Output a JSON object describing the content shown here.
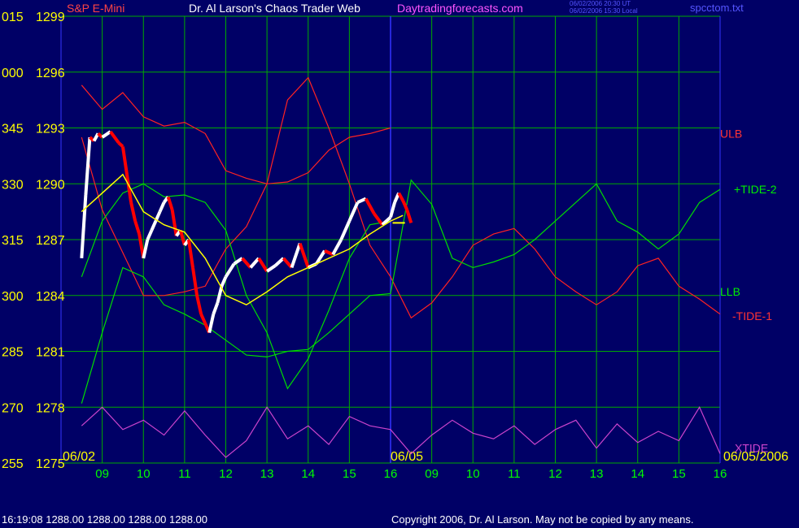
{
  "header": {
    "title": "Dr. Al Larson's Chaos Trader Web",
    "site": "Daytradingforecasts.com",
    "instrument": "S&P E-Mini",
    "stamp_line1": "06/02/2006 20:30 UT",
    "stamp_line2": "06/02/2006 15:30 Local",
    "file": "spcctom.txt"
  },
  "footer": {
    "quote": "16:19:08  1288.00  1288.00  1288.00  1288.00",
    "copyright": "Copyright 2006, Dr. Al Larson. May not be copied by any means."
  },
  "colors": {
    "background": "#000066",
    "grid": "#00aa00",
    "price_up": "#ffffff",
    "price_down": "#ff0000",
    "ulb_llb_bands": "#ff2222",
    "tide_green": "#00dd00",
    "xtide": "#cc44cc",
    "axis_labels": "#ffff00",
    "time_labels": "#00ff00"
  },
  "chart_data": {
    "type": "line",
    "title": "S&P E-Mini",
    "y_axis": {
      "ylim": [
        1275,
        1299
      ],
      "angle_ticks": [
        "015",
        "000",
        "345",
        "330",
        "315",
        "300",
        "285",
        "270",
        "255"
      ],
      "price_ticks": [
        "1299",
        "1296",
        "1293",
        "1290",
        "1287",
        "1284",
        "1281",
        "1278",
        "1275"
      ]
    },
    "x_axis": {
      "date_labels": [
        "06/02",
        "06/05",
        "06/05/2006"
      ],
      "hour_labels": [
        "09",
        "10",
        "11",
        "12",
        "13",
        "14",
        "15",
        "16",
        "09",
        "10",
        "11",
        "12",
        "13",
        "14",
        "15",
        "16"
      ]
    },
    "line_labels": [
      "ULB",
      "+TIDE-2",
      "LLB",
      "-TIDE-1",
      "XTIDE"
    ],
    "last_price": 1287.9,
    "series": [
      {
        "name": "ULB",
        "color": "#ff2222",
        "points": [
          [
            8.5,
            1295.3
          ],
          [
            9.0,
            1294.0
          ],
          [
            9.5,
            1294.9
          ],
          [
            10.0,
            1293.6
          ],
          [
            10.5,
            1293.1
          ],
          [
            11.0,
            1293.3
          ],
          [
            11.5,
            1292.7
          ],
          [
            12.0,
            1290.7
          ],
          [
            12.5,
            1290.3
          ],
          [
            13.0,
            1290.0
          ],
          [
            13.5,
            1290.1
          ],
          [
            14.0,
            1290.6
          ],
          [
            14.5,
            1291.8
          ],
          [
            15.0,
            1292.5
          ],
          [
            15.5,
            1292.7
          ],
          [
            16.0,
            1293.0
          ]
        ]
      },
      {
        "name": "LLB",
        "color": "#ff2222",
        "points": [
          [
            8.5,
            1292.5
          ],
          [
            9.0,
            1288.6
          ],
          [
            9.5,
            1286.3
          ],
          [
            10.0,
            1284.0
          ],
          [
            10.5,
            1284.0
          ],
          [
            11.0,
            1284.2
          ],
          [
            11.5,
            1284.5
          ],
          [
            12.0,
            1286.5
          ],
          [
            12.5,
            1287.7
          ],
          [
            13.0,
            1290.0
          ],
          [
            13.5,
            1294.5
          ],
          [
            14.0,
            1295.7
          ],
          [
            14.5,
            1293.0
          ],
          [
            15.0,
            1290.0
          ],
          [
            15.5,
            1286.7
          ],
          [
            16.0,
            1285.0
          ],
          [
            16.5,
            1282.8
          ],
          [
            17.0,
            1283.6
          ],
          [
            17.5,
            1285.0
          ],
          [
            18.0,
            1286.7
          ],
          [
            18.5,
            1287.3
          ],
          [
            19.0,
            1287.6
          ],
          [
            19.5,
            1286.5
          ],
          [
            20.0,
            1285.0
          ],
          [
            20.5,
            1284.2
          ],
          [
            21.0,
            1283.5
          ],
          [
            21.5,
            1284.2
          ],
          [
            22.0,
            1285.6
          ],
          [
            22.5,
            1286.0
          ],
          [
            23.0,
            1284.5
          ],
          [
            23.5,
            1283.8
          ],
          [
            24.0,
            1283.0
          ]
        ]
      },
      {
        "name": "+TIDE-2",
        "color": "#00dd00",
        "points": [
          [
            8.5,
            1278.2
          ],
          [
            9.0,
            1282.0
          ],
          [
            9.5,
            1285.5
          ],
          [
            10.0,
            1285.0
          ],
          [
            10.5,
            1283.5
          ],
          [
            11.0,
            1283.0
          ],
          [
            11.5,
            1282.4
          ],
          [
            12.0,
            1281.6
          ],
          [
            12.5,
            1280.8
          ],
          [
            13.0,
            1280.7
          ],
          [
            13.5,
            1281.0
          ],
          [
            14.0,
            1281.1
          ],
          [
            14.5,
            1282.0
          ],
          [
            15.0,
            1283.0
          ],
          [
            15.5,
            1284.0
          ],
          [
            16.0,
            1284.1
          ],
          [
            16.5,
            1290.2
          ],
          [
            17.0,
            1288.9
          ],
          [
            17.5,
            1286.0
          ],
          [
            18.0,
            1285.5
          ],
          [
            18.5,
            1285.8
          ],
          [
            19.0,
            1286.2
          ],
          [
            19.5,
            1287.0
          ],
          [
            20.0,
            1288.0
          ],
          [
            20.5,
            1289.0
          ],
          [
            21.0,
            1290.0
          ],
          [
            21.5,
            1288.0
          ],
          [
            22.0,
            1287.4
          ],
          [
            22.5,
            1286.5
          ],
          [
            23.0,
            1287.3
          ],
          [
            23.5,
            1289.0
          ],
          [
            24.0,
            1289.7
          ]
        ]
      },
      {
        "name": "-TIDE-1",
        "color": "#00dd00",
        "points": [
          [
            8.5,
            1285.0
          ],
          [
            9.0,
            1288.0
          ],
          [
            9.5,
            1289.5
          ],
          [
            10.0,
            1290.0
          ],
          [
            10.5,
            1289.3
          ],
          [
            11.0,
            1289.4
          ],
          [
            11.5,
            1289.0
          ],
          [
            12.0,
            1287.5
          ],
          [
            12.5,
            1284.0
          ],
          [
            13.0,
            1282.0
          ],
          [
            13.5,
            1279.0
          ],
          [
            14.0,
            1280.6
          ],
          [
            14.5,
            1283.2
          ],
          [
            15.0,
            1286.0
          ],
          [
            15.5,
            1287.8
          ],
          [
            16.0,
            1288.0
          ]
        ]
      },
      {
        "name": "XTIDE",
        "color": "#cc44cc",
        "points": [
          [
            8.5,
            1277.0
          ],
          [
            9.0,
            1278.0
          ],
          [
            9.5,
            1276.8
          ],
          [
            10.0,
            1277.3
          ],
          [
            10.5,
            1276.5
          ],
          [
            11.0,
            1277.8
          ],
          [
            11.5,
            1276.5
          ],
          [
            12.0,
            1275.3
          ],
          [
            12.5,
            1276.2
          ],
          [
            13.0,
            1278.0
          ],
          [
            13.5,
            1276.3
          ],
          [
            14.0,
            1277.0
          ],
          [
            14.5,
            1276.0
          ],
          [
            15.0,
            1277.5
          ],
          [
            15.5,
            1277.0
          ],
          [
            16.0,
            1276.8
          ],
          [
            16.5,
            1275.5
          ],
          [
            17.0,
            1276.5
          ],
          [
            17.5,
            1277.3
          ],
          [
            18.0,
            1276.6
          ],
          [
            18.5,
            1276.3
          ],
          [
            19.0,
            1277.0
          ],
          [
            19.5,
            1276.0
          ],
          [
            20.0,
            1276.8
          ],
          [
            20.5,
            1277.3
          ],
          [
            21.0,
            1275.8
          ],
          [
            21.5,
            1277.1
          ],
          [
            22.0,
            1276.1
          ],
          [
            22.5,
            1276.7
          ],
          [
            23.0,
            1276.2
          ],
          [
            23.5,
            1278.0
          ],
          [
            24.0,
            1275.5
          ]
        ]
      },
      {
        "name": "price",
        "color": "#ffffff",
        "points": [
          [
            8.5,
            1286.0
          ],
          [
            8.6,
            1289.4
          ],
          [
            8.7,
            1292.5
          ],
          [
            8.8,
            1292.3
          ],
          [
            8.9,
            1292.7
          ],
          [
            9.0,
            1292.5
          ],
          [
            9.2,
            1292.8
          ],
          [
            9.4,
            1292.2
          ],
          [
            9.5,
            1292.0
          ],
          [
            9.6,
            1290.5
          ],
          [
            9.7,
            1289.0
          ],
          [
            9.8,
            1288.0
          ],
          [
            9.9,
            1287.3
          ],
          [
            10.0,
            1286.0
          ],
          [
            10.1,
            1287.0
          ],
          [
            10.2,
            1287.5
          ],
          [
            10.3,
            1288.0
          ],
          [
            10.4,
            1288.5
          ],
          [
            10.5,
            1289.0
          ],
          [
            10.6,
            1289.3
          ],
          [
            10.7,
            1288.6
          ],
          [
            10.8,
            1287.2
          ],
          [
            10.9,
            1287.5
          ],
          [
            11.0,
            1286.7
          ],
          [
            11.1,
            1287.0
          ],
          [
            11.2,
            1285.5
          ],
          [
            11.3,
            1284.0
          ],
          [
            11.4,
            1283.0
          ],
          [
            11.5,
            1282.5
          ],
          [
            11.6,
            1282.0
          ],
          [
            11.7,
            1283.0
          ],
          [
            11.8,
            1283.6
          ],
          [
            11.9,
            1284.5
          ],
          [
            12.0,
            1285.0
          ],
          [
            12.2,
            1285.7
          ],
          [
            12.4,
            1286.0
          ],
          [
            12.6,
            1285.5
          ],
          [
            12.8,
            1286.0
          ],
          [
            13.0,
            1285.3
          ],
          [
            13.2,
            1285.6
          ],
          [
            13.4,
            1286.0
          ],
          [
            13.6,
            1285.5
          ],
          [
            13.8,
            1286.8
          ],
          [
            14.0,
            1285.5
          ],
          [
            14.2,
            1285.7
          ],
          [
            14.4,
            1286.4
          ],
          [
            14.6,
            1286.2
          ],
          [
            14.8,
            1287.0
          ],
          [
            15.0,
            1288.0
          ],
          [
            15.2,
            1289.0
          ],
          [
            15.4,
            1289.2
          ],
          [
            15.6,
            1288.4
          ],
          [
            15.8,
            1287.8
          ],
          [
            16.0,
            1288.2
          ],
          [
            16.1,
            1289.0
          ],
          [
            16.2,
            1289.5
          ],
          [
            16.3,
            1289.1
          ],
          [
            16.4,
            1288.6
          ],
          [
            16.5,
            1287.9
          ]
        ]
      },
      {
        "name": "moving-average",
        "color": "#ffff00",
        "points": [
          [
            8.5,
            1288.5
          ],
          [
            9.0,
            1289.5
          ],
          [
            9.5,
            1290.5
          ],
          [
            10.0,
            1288.5
          ],
          [
            10.5,
            1287.8
          ],
          [
            11.0,
            1287.4
          ],
          [
            11.5,
            1286.0
          ],
          [
            12.0,
            1284.0
          ],
          [
            12.5,
            1283.5
          ],
          [
            13.0,
            1284.2
          ],
          [
            13.5,
            1285.0
          ],
          [
            14.0,
            1285.5
          ],
          [
            14.5,
            1286.0
          ],
          [
            15.0,
            1286.5
          ],
          [
            15.5,
            1287.3
          ],
          [
            16.0,
            1288.0
          ],
          [
            16.3,
            1288.3
          ]
        ]
      }
    ]
  }
}
